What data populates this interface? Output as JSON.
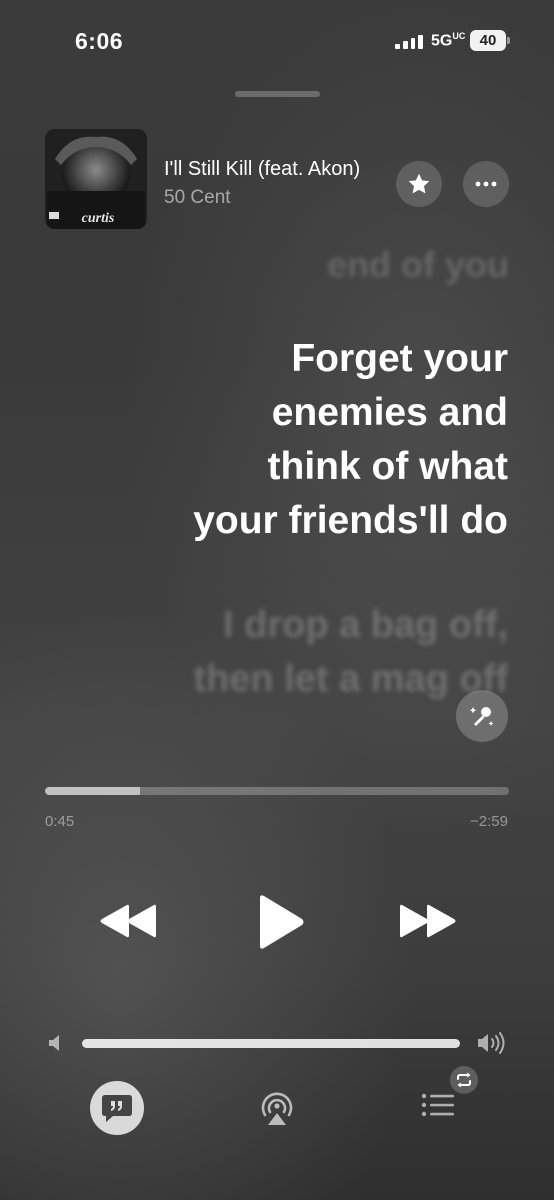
{
  "status_bar": {
    "time": "6:06",
    "network": "5G",
    "network_suffix": "UC",
    "battery": "40"
  },
  "now_playing": {
    "title": "I'll Still Kill (feat. Akon)",
    "artist": "50 Cent",
    "album_art_text": "curtis"
  },
  "lyrics": {
    "previous": "end of you",
    "current": [
      "Forget your",
      "enemies and",
      "think of what",
      "your friends'll do"
    ],
    "next": [
      "I drop a bag off,",
      "then let a mag off"
    ]
  },
  "playback": {
    "elapsed": "0:45",
    "remaining": "−2:59",
    "progress_fraction": 0.205
  },
  "volume": {
    "level_fraction": 1.0
  },
  "icons": {
    "star": "star-icon",
    "more": "ellipsis-icon",
    "sing": "microphone-sparkle-icon",
    "rewind": "rewind-icon",
    "play": "play-icon",
    "forward": "fast-forward-icon",
    "lyrics": "quote-bubble-icon",
    "airplay": "airplay-icon",
    "queue": "queue-list-icon",
    "repeat": "repeat-icon"
  },
  "colors": {
    "background": "#3b3b3b",
    "text": "#ffffff"
  }
}
